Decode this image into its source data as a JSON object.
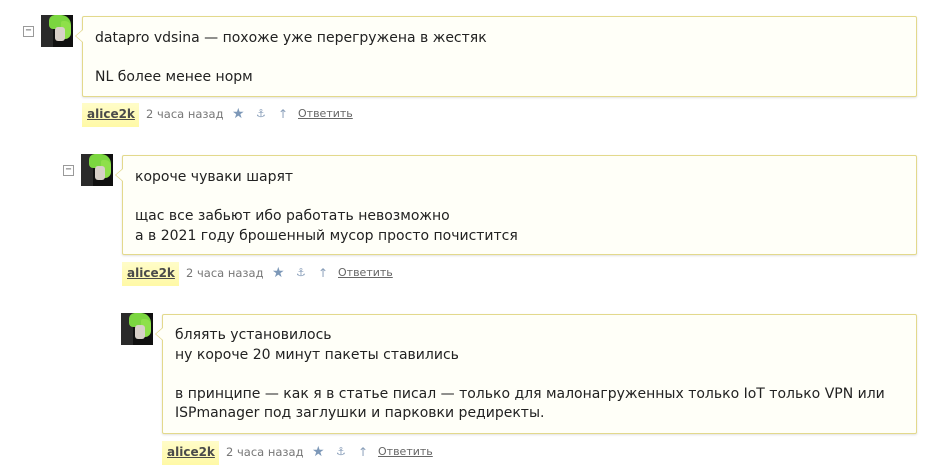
{
  "comments": [
    {
      "collapse": "−",
      "lines": [
        "datapro vdsina — похоже уже перегружена в жестяк",
        "",
        "NL более менее норм"
      ],
      "author": "alice2k",
      "time": "2 часа назад",
      "reply": "Ответить"
    },
    {
      "collapse": "−",
      "lines": [
        "короче чуваки шарят",
        "",
        "щас все забьют ибо работать невозможно",
        "а в 2021 году брошенный мусор просто почистится"
      ],
      "author": "alice2k",
      "time": "2 часа назад",
      "reply": "Ответить"
    },
    {
      "lines": [
        "бляять установилось",
        "ну короче 20 минут пакеты ставились",
        "",
        "в принципе — как я в статье писал — только для малонагруженных только IoT только VPN или",
        "ISPmanager под заглушки и парковки редиректы."
      ],
      "author": "alice2k",
      "time": "2 часа назад",
      "reply": "Ответить"
    }
  ],
  "icons": {
    "star": "★",
    "anchor": "⚓",
    "up": "↑"
  },
  "colors": {
    "bubble_bg": "#fffff8",
    "bubble_border": "#e3d98c",
    "author_highlight": "#fff9a6",
    "icon_blue": "#7d98b8"
  }
}
